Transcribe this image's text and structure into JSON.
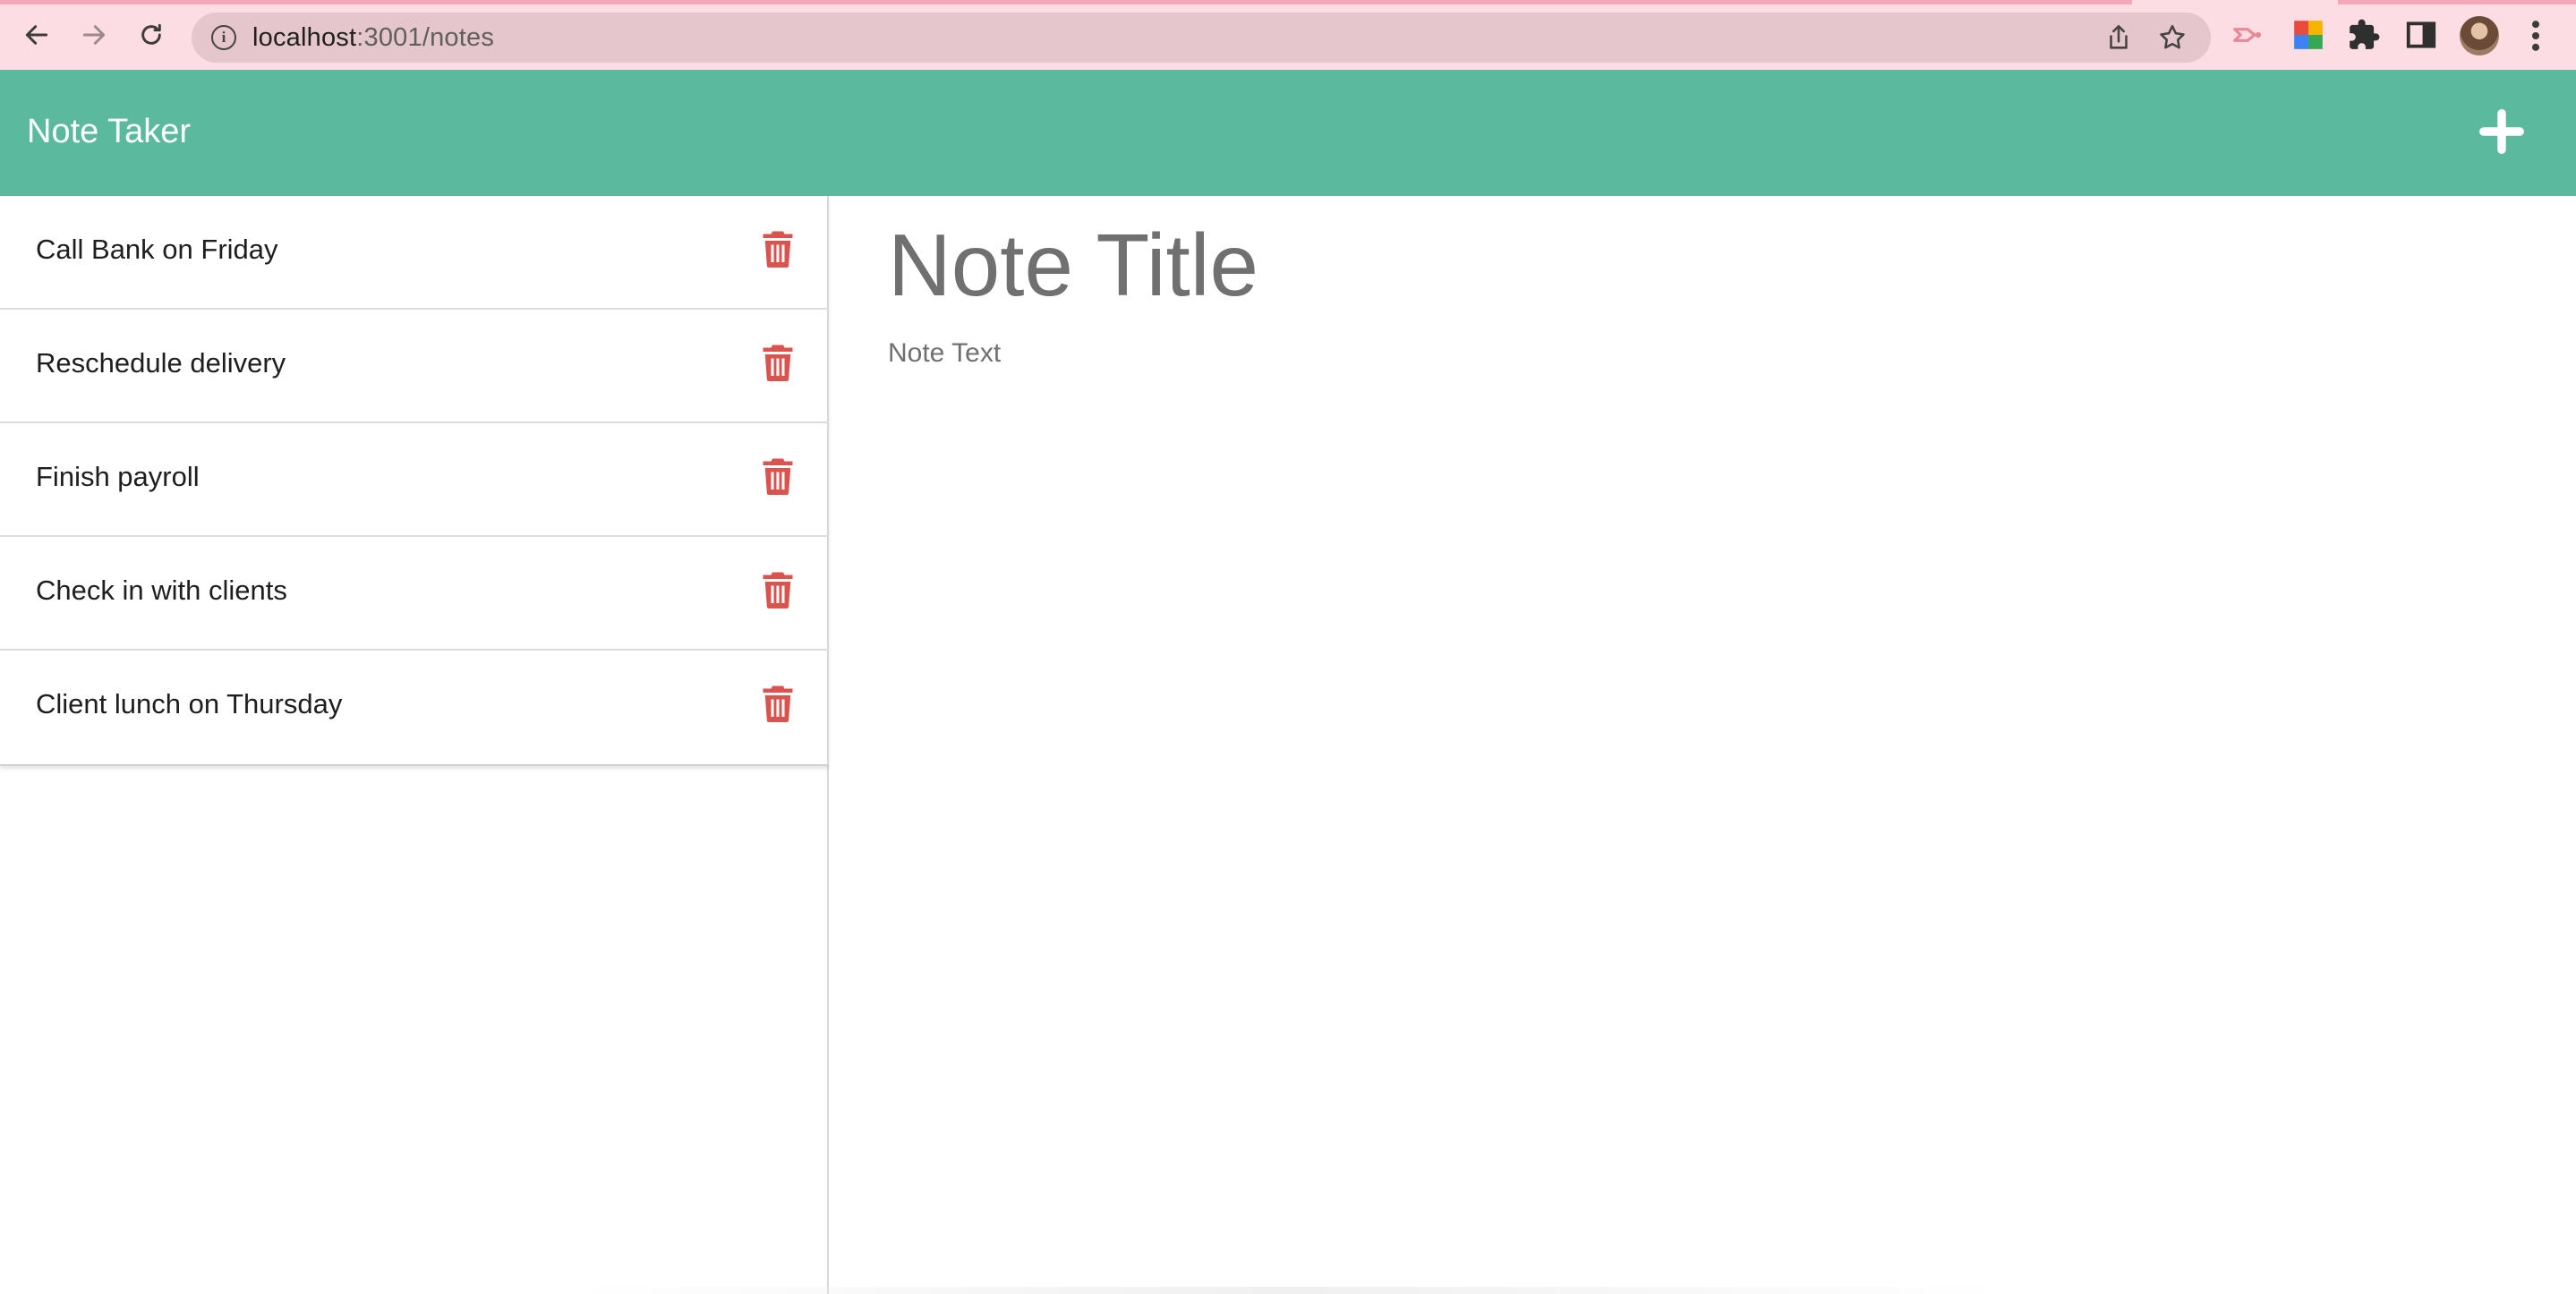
{
  "browser": {
    "url_host": "localhost",
    "url_path": ":3001/notes",
    "icons": [
      "back-icon",
      "forward-icon",
      "reload-icon",
      "info-icon",
      "share-icon",
      "star-icon",
      "extension-icon",
      "puzzle-icon",
      "side-panel-icon",
      "avatar",
      "kebab-menu-icon"
    ]
  },
  "app": {
    "brand": "Note Taker",
    "header_color": "#5bb99d",
    "add_icon": "plus-icon"
  },
  "notes": [
    {
      "title": "Call Bank on Friday"
    },
    {
      "title": "Reschedule delivery"
    },
    {
      "title": "Finish payroll"
    },
    {
      "title": "Check in with clients"
    },
    {
      "title": "Client lunch on Thursday"
    }
  ],
  "editor": {
    "title_placeholder": "Note Title",
    "text_placeholder": "Note Text"
  },
  "colors": {
    "trash": "#d9534f",
    "placeholder": "#707070"
  }
}
